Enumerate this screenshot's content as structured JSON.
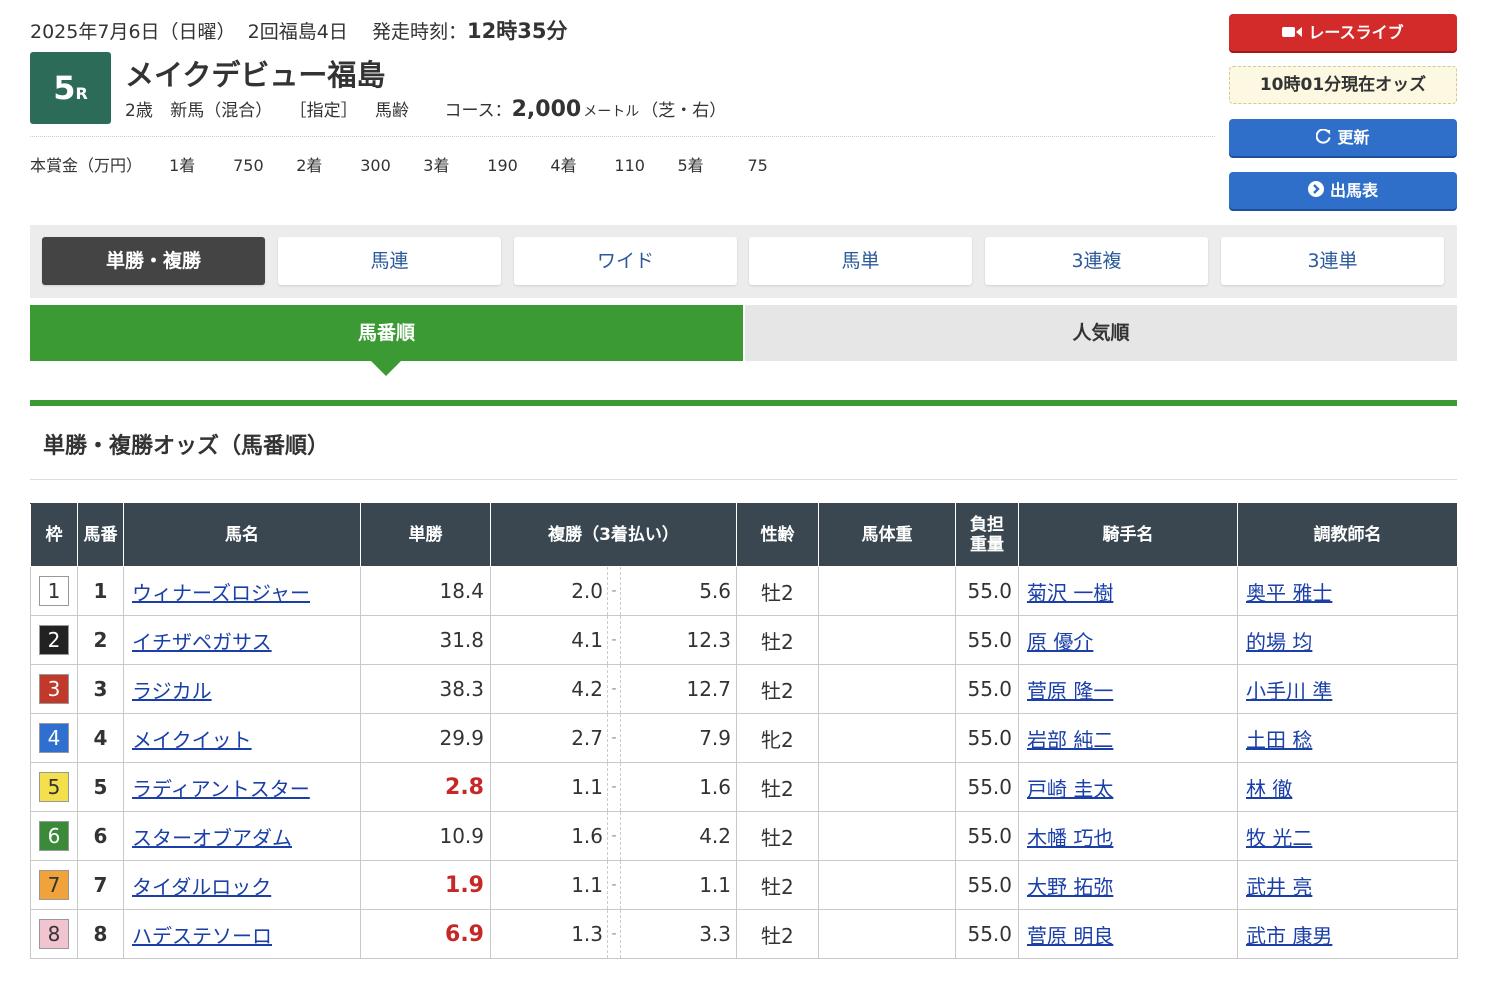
{
  "race": {
    "date": "2025年7月6日（日曜）",
    "meeting": "2回福島4日",
    "post_label": "発走時刻：",
    "post_time": "12時35分",
    "race_number": "5",
    "race_suffix": "R",
    "race_name": "メイクデビュー福島",
    "age": "2歳",
    "class": "新馬（混合）",
    "condition": "［指定］",
    "weight_rule": "馬齢",
    "course_label": "コース：",
    "distance": "2,000",
    "distance_unit": "メートル",
    "surface": "（芝・右）",
    "prize_label": "本賞金（万円）",
    "prizes": [
      {
        "place": "1着",
        "amount": "750"
      },
      {
        "place": "2着",
        "amount": "300"
      },
      {
        "place": "3着",
        "amount": "190"
      },
      {
        "place": "4着",
        "amount": "110"
      },
      {
        "place": "5着",
        "amount": "75"
      }
    ]
  },
  "side": {
    "live_label": "レースライブ",
    "odds_time": "10時01分現在オッズ",
    "update_label": "更新",
    "entry_label": "出馬表"
  },
  "bet_tabs": [
    "単勝・複勝",
    "馬連",
    "ワイド",
    "馬単",
    "3連複",
    "3連単"
  ],
  "sort_tabs": {
    "by_number": "馬番順",
    "by_popularity": "人気順"
  },
  "section_title": "単勝・複勝オッズ（馬番順）",
  "table": {
    "headers": {
      "waku": "枠",
      "umaban": "馬番",
      "horse": "馬名",
      "win": "単勝",
      "place": "複勝（3着払い）",
      "sexage": "性齢",
      "bodyweight": "馬体重",
      "weight_1": "負担",
      "weight_2": "重量",
      "jockey": "騎手名",
      "trainer": "調教師名"
    },
    "rows": [
      {
        "waku": "1",
        "umaban": "1",
        "horse": "ウィナーズロジャー",
        "win": "18.4",
        "place_min": "2.0",
        "place_max": "5.6",
        "sexage": "牡2",
        "bodyweight": "",
        "weight": "55.0",
        "jockey": "菊沢 一樹",
        "trainer": "奥平 雅士"
      },
      {
        "waku": "2",
        "umaban": "2",
        "horse": "イチザペガサス",
        "win": "31.8",
        "place_min": "4.1",
        "place_max": "12.3",
        "sexage": "牡2",
        "bodyweight": "",
        "weight": "55.0",
        "jockey": "原 優介",
        "trainer": "的場 均"
      },
      {
        "waku": "3",
        "umaban": "3",
        "horse": "ラジカル",
        "win": "38.3",
        "place_min": "4.2",
        "place_max": "12.7",
        "sexage": "牡2",
        "bodyweight": "",
        "weight": "55.0",
        "jockey": "菅原 隆一",
        "trainer": "小手川 準"
      },
      {
        "waku": "4",
        "umaban": "4",
        "horse": "メイクイット",
        "win": "29.9",
        "place_min": "2.7",
        "place_max": "7.9",
        "sexage": "牝2",
        "bodyweight": "",
        "weight": "55.0",
        "jockey": "岩部 純二",
        "trainer": "土田 稔"
      },
      {
        "waku": "5",
        "umaban": "5",
        "horse": "ラディアントスター",
        "win": "2.8",
        "place_min": "1.1",
        "place_max": "1.6",
        "sexage": "牡2",
        "bodyweight": "",
        "weight": "55.0",
        "jockey": "戸崎 圭太",
        "trainer": "林 徹"
      },
      {
        "waku": "6",
        "umaban": "6",
        "horse": "スターオブアダム",
        "win": "10.9",
        "place_min": "1.6",
        "place_max": "4.2",
        "sexage": "牡2",
        "bodyweight": "",
        "weight": "55.0",
        "jockey": "木幡 巧也",
        "trainer": "牧 光二"
      },
      {
        "waku": "7",
        "umaban": "7",
        "horse": "タイダルロック",
        "win": "1.9",
        "place_min": "1.1",
        "place_max": "1.1",
        "sexage": "牡2",
        "bodyweight": "",
        "weight": "55.0",
        "jockey": "大野 拓弥",
        "trainer": "武井 亮"
      },
      {
        "waku": "8",
        "umaban": "8",
        "horse": "ハデステソーロ",
        "win": "6.9",
        "place_min": "1.3",
        "place_max": "3.3",
        "sexage": "牡2",
        "bodyweight": "",
        "weight": "55.0",
        "jockey": "菅原 明良",
        "trainer": "武市 康男"
      }
    ]
  },
  "colors": {
    "waku": {
      "1": {
        "bg": "#ffffff",
        "fg": "#333333"
      },
      "2": {
        "bg": "#222222",
        "fg": "#ffffff"
      },
      "3": {
        "bg": "#c0392b",
        "fg": "#ffffff"
      },
      "4": {
        "bg": "#2e6fcf",
        "fg": "#ffffff"
      },
      "5": {
        "bg": "#f4e04d",
        "fg": "#333333"
      },
      "6": {
        "bg": "#3b8a3a",
        "fg": "#ffffff"
      },
      "7": {
        "bg": "#f0a23b",
        "fg": "#333333"
      },
      "8": {
        "bg": "#f2c4cf",
        "fg": "#333333"
      }
    },
    "favorite_odds": "#c62828",
    "accent_green": "#3b9a34"
  }
}
